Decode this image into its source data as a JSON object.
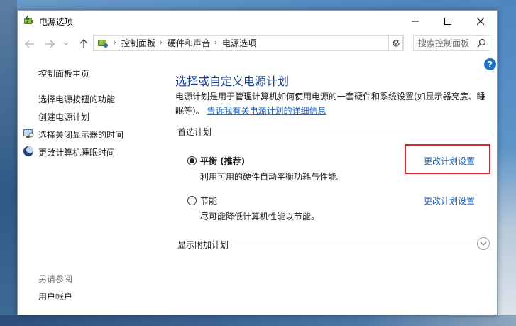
{
  "window": {
    "title": "电源选项"
  },
  "address_bar": {
    "breadcrumbs": [
      "控制面板",
      "硬件和声音",
      "电源选项"
    ],
    "search_placeholder": "搜索控制面板"
  },
  "sidebar": {
    "home": "控制面板主页",
    "links": [
      {
        "label": "选择电源按钮的功能",
        "icon": ""
      },
      {
        "label": "创建电源计划",
        "icon": ""
      },
      {
        "label": "选择关闭显示器的时间",
        "icon": "monitor-icon"
      },
      {
        "label": "更改计算机睡眠时间",
        "icon": "moon-icon"
      }
    ],
    "see_also_title": "另请参阅",
    "see_also_links": [
      "用户帐户"
    ]
  },
  "main": {
    "title": "选择或自定义电源计划",
    "desc_line1": "电源计划是用于管理计算机如何使用电源的一套硬件和系统设置(如显示器亮度、睡",
    "desc_line2_prefix": "眠等)。",
    "learn_more": "告诉我有关电源计划的详细信息",
    "preferred_group": "首选计划",
    "plans": [
      {
        "name": "平衡 (推荐)",
        "description": "利用可用的硬件自动平衡功耗与性能。",
        "selected": true,
        "change_link": "更改计划设置"
      },
      {
        "name": "节能",
        "description": "尽可能降低计算机性能以节能。",
        "selected": false,
        "change_link": "更改计划设置"
      }
    ],
    "additional_group": "显示附加计划"
  },
  "colors": {
    "link": "#1a64c8",
    "title": "#1a3e8a",
    "highlight": "#e0242a"
  }
}
